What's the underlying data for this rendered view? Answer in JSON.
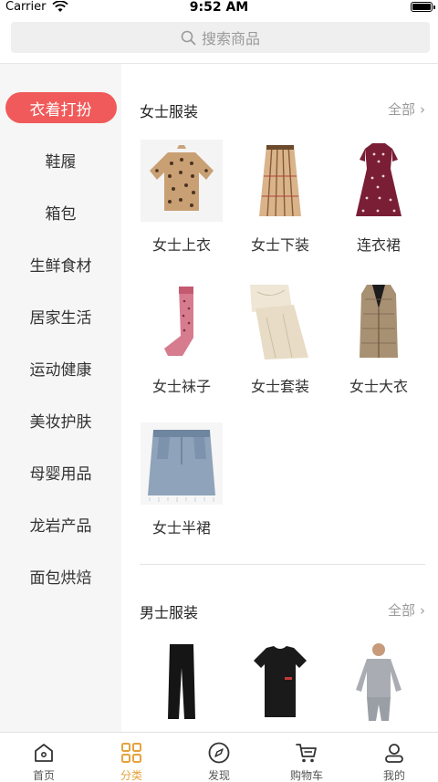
{
  "status_bar": {
    "carrier": "Carrier",
    "time": "9:52 AM"
  },
  "search": {
    "placeholder": "搜索商品"
  },
  "sidebar": {
    "items": [
      {
        "label": "衣着打扮",
        "active": true
      },
      {
        "label": "鞋履"
      },
      {
        "label": "箱包"
      },
      {
        "label": "生鲜食材"
      },
      {
        "label": "居家生活"
      },
      {
        "label": "运动健康"
      },
      {
        "label": "美妆护肤"
      },
      {
        "label": "母婴用品"
      },
      {
        "label": "龙岩产品"
      },
      {
        "label": "面包烘焙"
      }
    ]
  },
  "sections": [
    {
      "title": "女士服装",
      "more": "全部",
      "items": [
        {
          "name": "女士上衣",
          "icon": "blouse-image"
        },
        {
          "name": "女士下装",
          "icon": "skirt-image"
        },
        {
          "name": "连衣裙",
          "icon": "dress-image"
        },
        {
          "name": "女士袜子",
          "icon": "sock-image"
        },
        {
          "name": "女士套装",
          "icon": "suit-set-image"
        },
        {
          "name": "女士大衣",
          "icon": "coat-image"
        },
        {
          "name": "女士半裙",
          "icon": "denim-skirt-image"
        }
      ]
    },
    {
      "title": "男士服装",
      "more": "全部",
      "items": [
        {
          "icon": "pants-image"
        },
        {
          "icon": "tshirt-image"
        },
        {
          "icon": "thermal-set-image"
        }
      ]
    }
  ],
  "tab_bar": {
    "tabs": [
      {
        "label": "首页",
        "icon": "home-icon"
      },
      {
        "label": "分类",
        "icon": "category-icon",
        "active": true
      },
      {
        "label": "发现",
        "icon": "compass-icon"
      },
      {
        "label": "购物车",
        "icon": "cart-icon"
      },
      {
        "label": "我的",
        "icon": "profile-icon"
      }
    ]
  },
  "colors": {
    "accent": "#f05a5a",
    "tab_active": "#e6a23c"
  }
}
